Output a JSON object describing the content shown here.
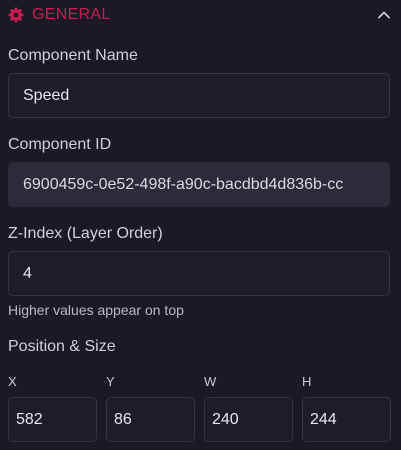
{
  "section": {
    "title": "GENERAL",
    "icon": "gear-icon",
    "accent_color": "#c41d4f",
    "collapse_icon": "chevron-up-icon"
  },
  "component_name": {
    "label": "Component Name",
    "value": "Speed"
  },
  "component_id": {
    "label": "Component ID",
    "value": "6900459c-0e52-498f-a90c-bacdbd4d836b-cc"
  },
  "z_index": {
    "label": "Z-Index (Layer Order)",
    "value": "4",
    "hint": "Higher values appear on top"
  },
  "position_size": {
    "label": "Position & Size",
    "x": {
      "label": "X",
      "value": "582"
    },
    "y": {
      "label": "Y",
      "value": "86"
    },
    "w": {
      "label": "W",
      "value": "240"
    },
    "h": {
      "label": "H",
      "value": "244"
    }
  }
}
